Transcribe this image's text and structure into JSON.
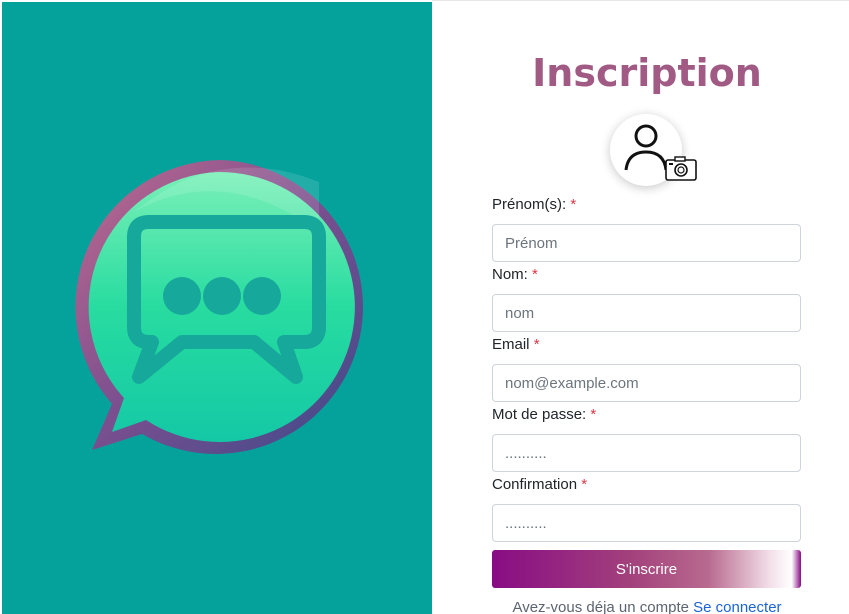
{
  "header": {
    "title": "Inscription"
  },
  "avatar": {
    "icon": "user-icon",
    "camera_icon": "camera-icon"
  },
  "form": {
    "fields": [
      {
        "label": "Prénom(s):",
        "required": "*",
        "placeholder": "Prénom",
        "type": "text"
      },
      {
        "label": "Nom:",
        "required": "*",
        "placeholder": "nom",
        "type": "text"
      },
      {
        "label": "Email",
        "required": "*",
        "placeholder": "nom@example.com",
        "type": "email"
      },
      {
        "label": "Mot de passe:",
        "required": "*",
        "placeholder": "..........",
        "type": "password"
      },
      {
        "label": "Confirmation",
        "required": "*",
        "placeholder": "..........",
        "type": "password"
      }
    ],
    "submit_label": "S'inscrire"
  },
  "footer": {
    "text": "Avez-vous déja un compte",
    "link": "Se connecter"
  },
  "colors": {
    "left_panel": "#05a29c",
    "title": "#a05a83",
    "submit": "#880c84",
    "link": "#1a64d6",
    "required": "#dc3545"
  }
}
